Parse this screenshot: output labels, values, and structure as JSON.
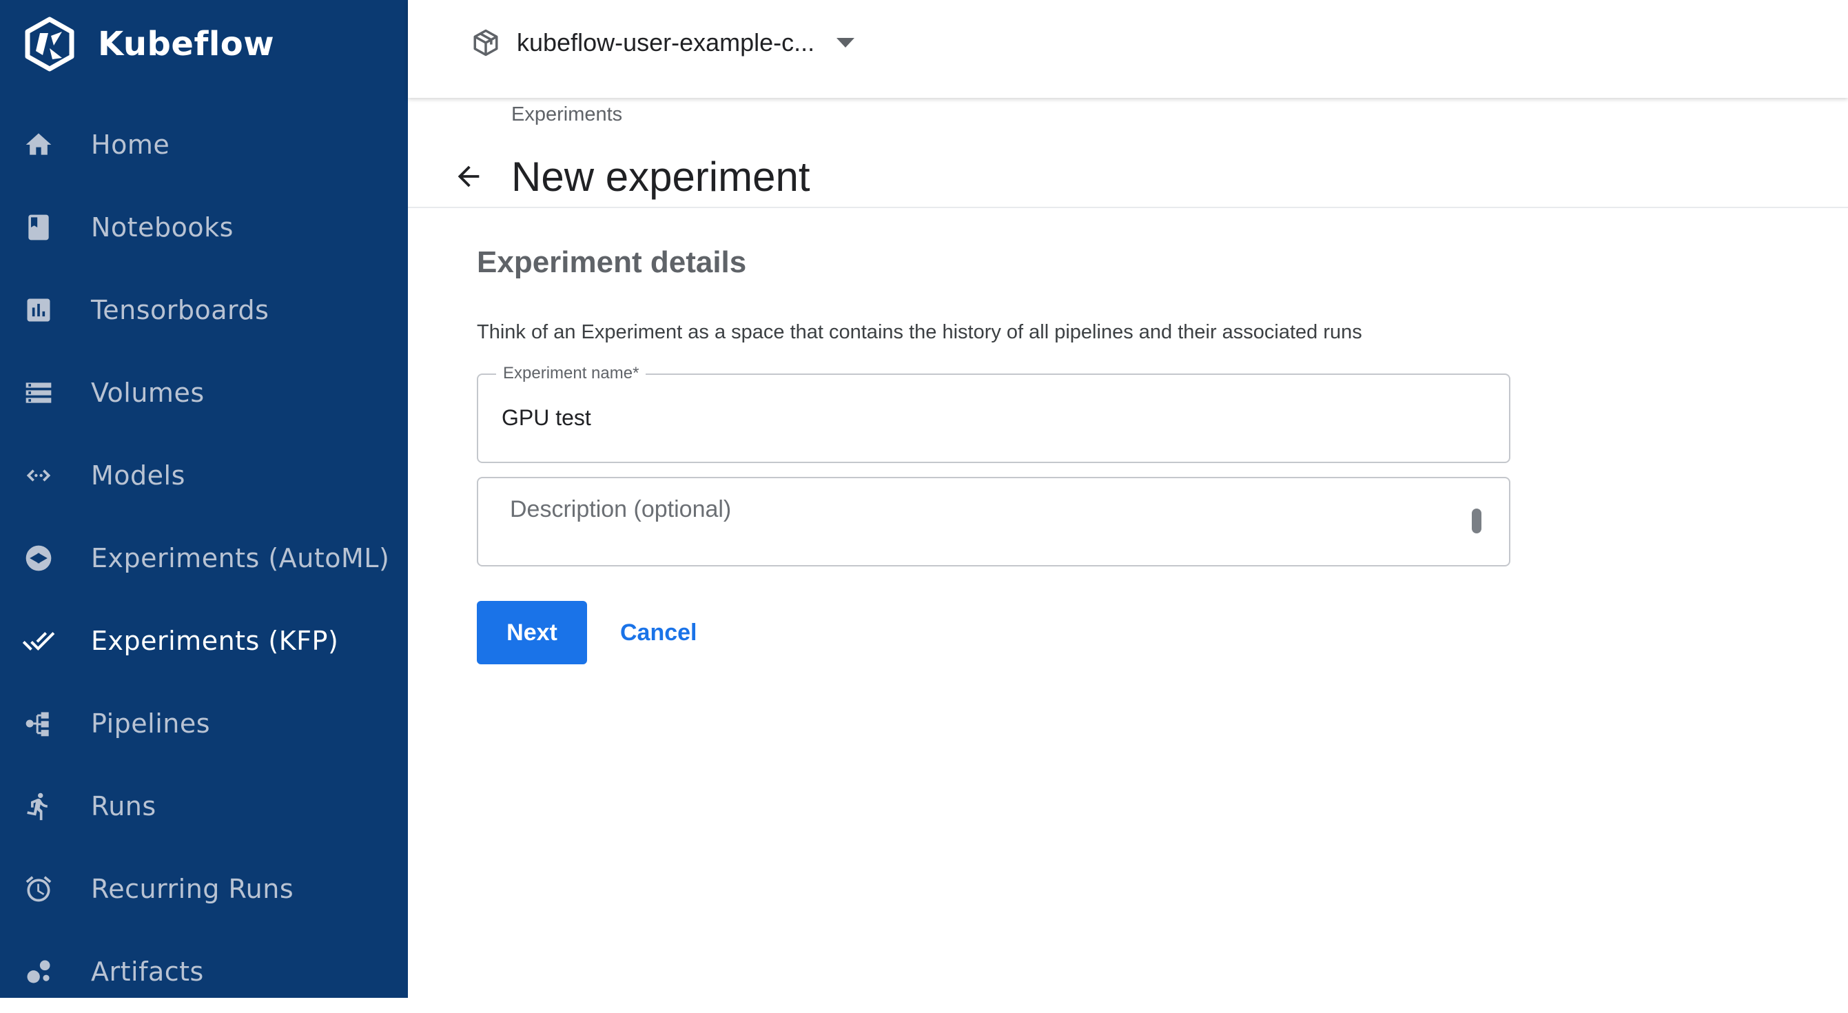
{
  "brand": {
    "name": "Kubeflow",
    "icon": "kubeflow-logo-icon"
  },
  "colors": {
    "sidebar_bg": "#0b3a72",
    "sidebar_text": "#b9c3d3",
    "sidebar_active_text": "#ffffff",
    "primary": "#1a73e8"
  },
  "sidebar": {
    "items": [
      {
        "label": "Home",
        "icon": "home-icon",
        "active": false
      },
      {
        "label": "Notebooks",
        "icon": "notebook-icon",
        "active": false
      },
      {
        "label": "Tensorboards",
        "icon": "bar-chart-icon",
        "active": false
      },
      {
        "label": "Volumes",
        "icon": "storage-icon",
        "active": false
      },
      {
        "label": "Models",
        "icon": "code-arrows-icon",
        "active": false
      },
      {
        "label": "Experiments (AutoML)",
        "icon": "automl-icon",
        "active": false
      },
      {
        "label": "Experiments (KFP)",
        "icon": "done-all-icon",
        "active": true
      },
      {
        "label": "Pipelines",
        "icon": "pipeline-icon",
        "active": false
      },
      {
        "label": "Runs",
        "icon": "running-icon",
        "active": false
      },
      {
        "label": "Recurring Runs",
        "icon": "alarm-icon",
        "active": false
      },
      {
        "label": "Artifacts",
        "icon": "artifacts-icon",
        "active": false
      }
    ]
  },
  "topbar": {
    "namespace": "kubeflow-user-example-c...",
    "namespace_icon": "package-icon",
    "caret_icon": "caret-down-icon"
  },
  "header": {
    "breadcrumb": "Experiments",
    "title": "New experiment",
    "back_icon": "arrow-back-icon"
  },
  "form": {
    "section_title": "Experiment details",
    "description": "Think of an Experiment as a space that contains the history of all pipelines and their associated runs",
    "name_field": {
      "label": "Experiment name*",
      "value": "GPU test"
    },
    "description_field": {
      "placeholder": "Description (optional)",
      "value": ""
    },
    "next_label": "Next",
    "cancel_label": "Cancel"
  }
}
